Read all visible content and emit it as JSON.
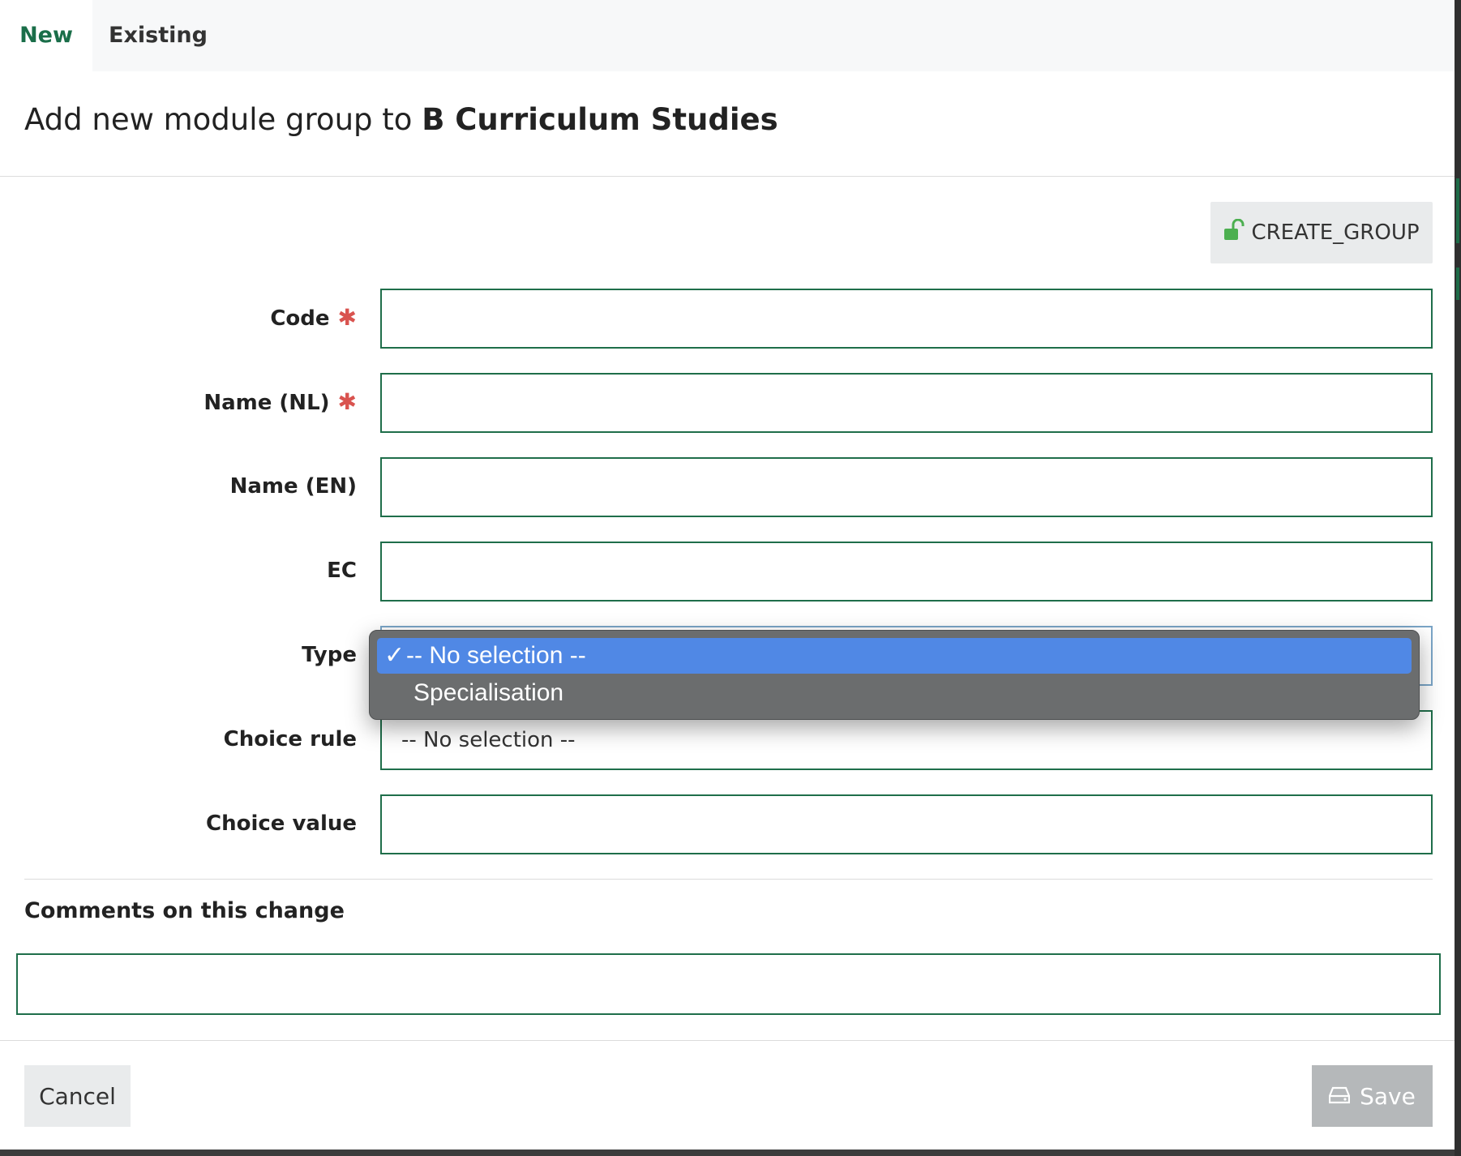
{
  "tabs": [
    {
      "label": "New",
      "active": true
    },
    {
      "label": "Existing",
      "active": false
    }
  ],
  "title": {
    "prefix": "Add new module group to",
    "target": "B Curriculum Studies"
  },
  "permission_button": {
    "label": "CREATE_GROUP",
    "icon": "unlock-icon",
    "color": "#4caf50"
  },
  "form": {
    "code_label": "Code",
    "name_nl_label": "Name (NL)",
    "name_en_label": "Name (EN)",
    "ec_label": "EC",
    "type_label": "Type",
    "choice_rule_label": "Choice rule",
    "choice_rule_value": "-- No selection --",
    "choice_value_label": "Choice value",
    "required_marker": "✱"
  },
  "type_dropdown": {
    "options": [
      {
        "label": "-- No selection --",
        "selected": true
      },
      {
        "label": "Specialisation",
        "selected": false
      }
    ],
    "check_mark": "✓"
  },
  "comments": {
    "label": "Comments on this change"
  },
  "footer": {
    "cancel_label": "Cancel",
    "save_label": "Save",
    "save_icon": "drive-icon"
  },
  "colors": {
    "accent": "#1a6e49",
    "required": "#d9534f",
    "selection": "#5088e5"
  }
}
